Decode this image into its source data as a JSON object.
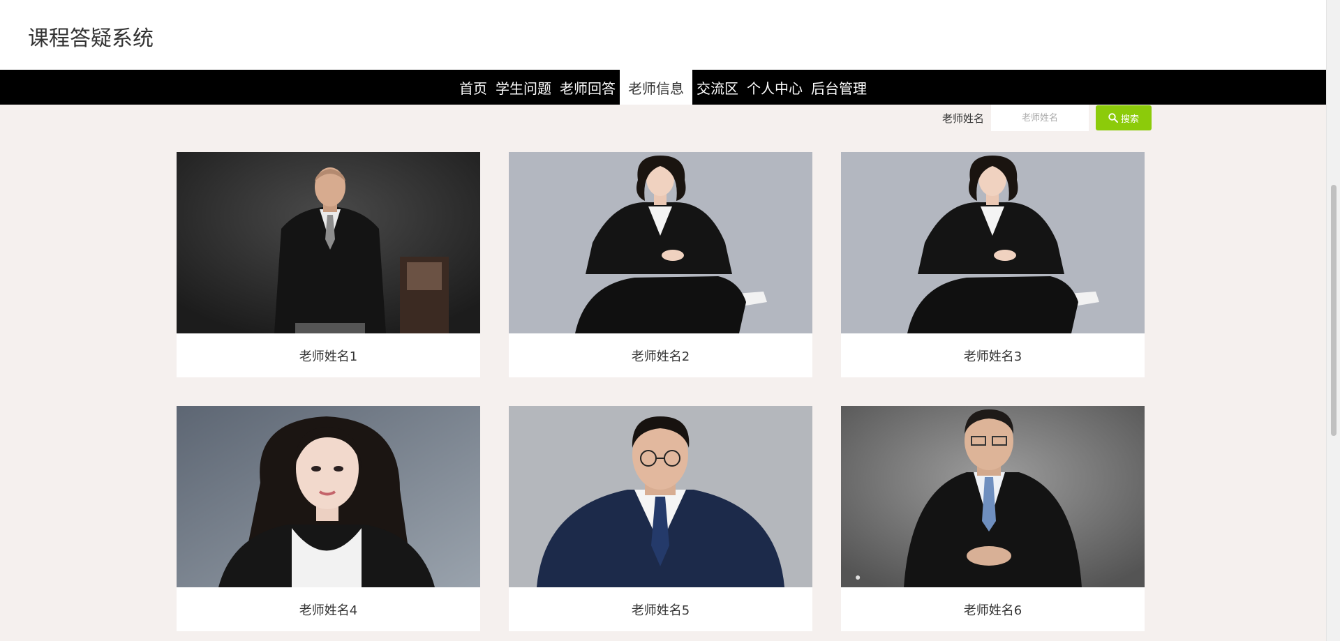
{
  "header": {
    "title": "课程答疑系统"
  },
  "nav": {
    "items": [
      {
        "label": "首页"
      },
      {
        "label": "学生问题"
      },
      {
        "label": "老师回答"
      },
      {
        "label": "老师信息"
      },
      {
        "label": "交流区"
      },
      {
        "label": "个人中心"
      },
      {
        "label": "后台管理"
      }
    ],
    "active_index": 3
  },
  "search": {
    "label": "老师姓名",
    "placeholder": "老师姓名",
    "button_label": "搜索",
    "button_icon": "search-icon"
  },
  "teachers": [
    {
      "name": "老师姓名1",
      "photo": "portrait-man-bald-dark-suit"
    },
    {
      "name": "老师姓名2",
      "photo": "portrait-woman-seated-black-suit"
    },
    {
      "name": "老师姓名3",
      "photo": "portrait-woman-seated-black-suit"
    },
    {
      "name": "老师姓名4",
      "photo": "portrait-woman-long-hair"
    },
    {
      "name": "老师姓名5",
      "photo": "portrait-man-glasses-navy-suit"
    },
    {
      "name": "老师姓名6",
      "photo": "portrait-man-glasses-black-suit"
    }
  ],
  "colors": {
    "nav_background": "#000000",
    "search_button": "#8ccb0a",
    "page_background": "#f5f0ee"
  }
}
